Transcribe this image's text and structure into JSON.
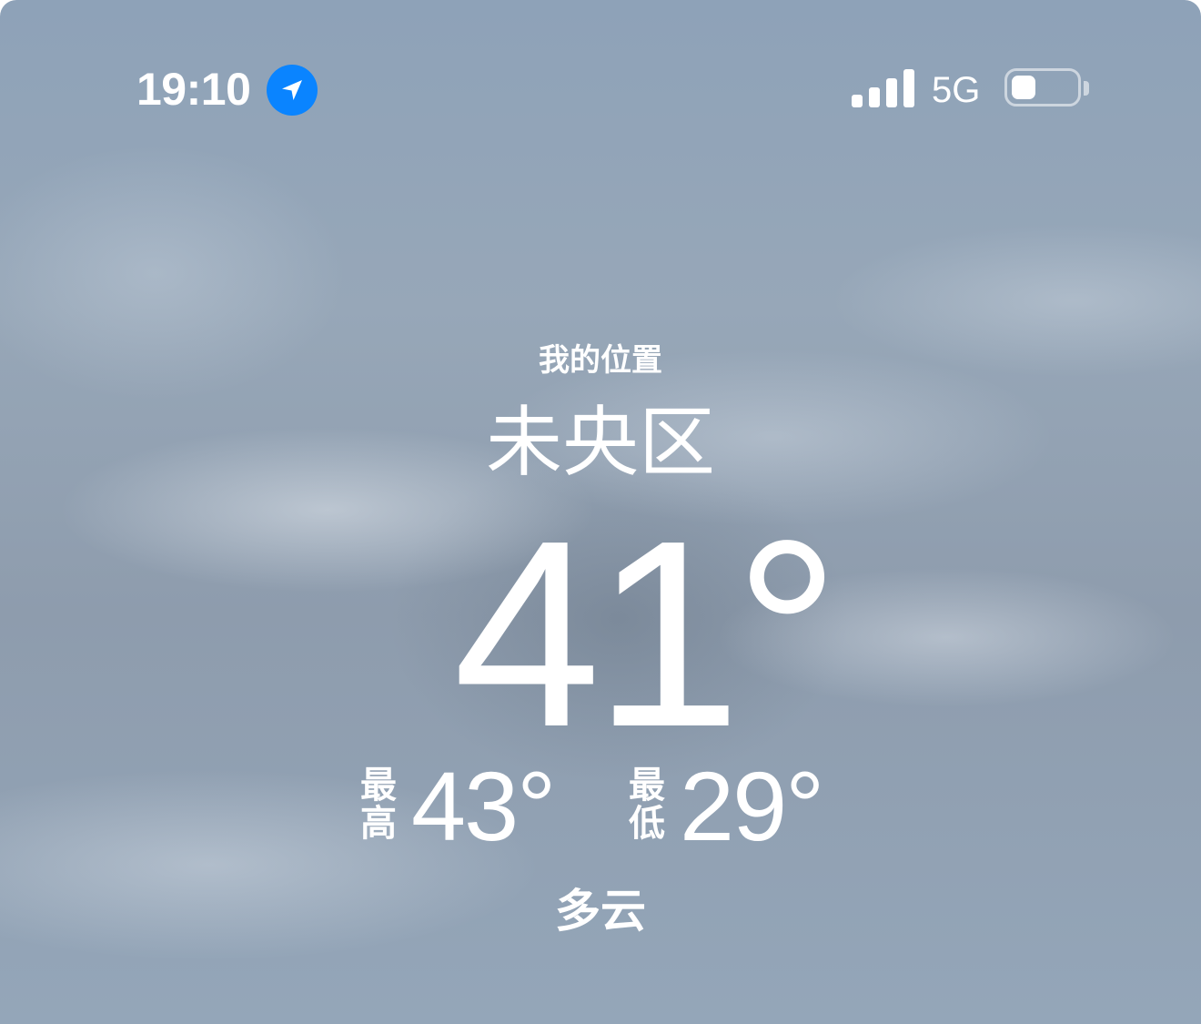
{
  "status_bar": {
    "time": "19:10",
    "location_icon": "location-arrow-icon",
    "signal_icon": "cellular-signal-icon",
    "network": "5G",
    "battery_icon": "battery-low-icon",
    "battery_level": 0.2,
    "location_badge_color": "#0a84ff"
  },
  "weather": {
    "location_caption": "我的位置",
    "city": "未央区",
    "current_temp": "41°",
    "high_label": "最高",
    "high_value": "43°",
    "low_label": "最低",
    "low_value": "29°",
    "condition": "多云"
  }
}
